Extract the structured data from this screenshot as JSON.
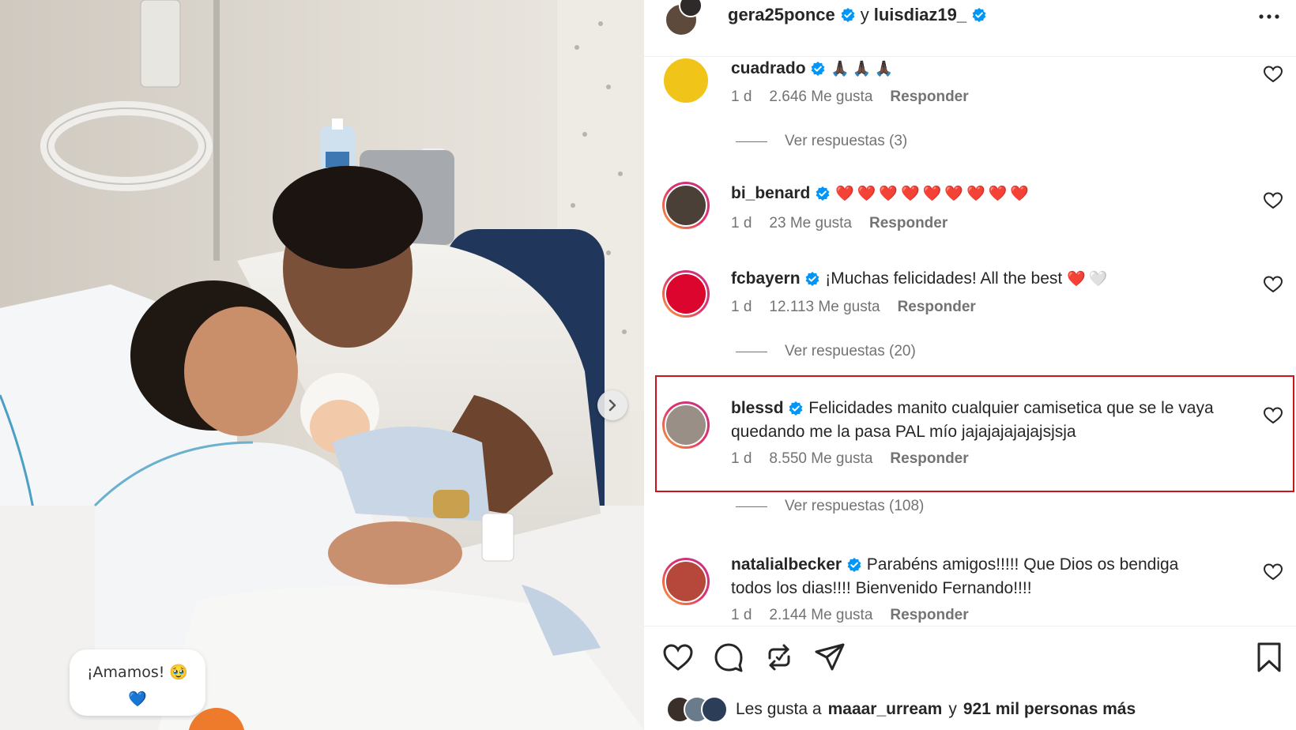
{
  "photo": {
    "overlay_text": "¡Amamos! 🥹",
    "overlay_emoji": "💙",
    "next_icon": "chevron-right-icon"
  },
  "header": {
    "user1": "gera25ponce",
    "connector": "y",
    "user2": "luisdiaz19_",
    "more_icon": "more-options-icon"
  },
  "comments": [
    {
      "user": "cuadrado",
      "verified": true,
      "text": "",
      "emoji": "🙏🏿🙏🏿🙏🏿",
      "time": "1 d",
      "likes": "2.646 Me gusta",
      "reply": "Responder",
      "view_replies": "Ver respuestas (3)",
      "avatar_color": "#f0c419"
    },
    {
      "user": "bi_benard",
      "verified": true,
      "text": "",
      "emoji": "❤️❤️❤️❤️❤️❤️❤️❤️❤️",
      "time": "1 d",
      "likes": "23 Me gusta",
      "reply": "Responder",
      "view_replies": "",
      "avatar_color": "#4a4038"
    },
    {
      "user": "fcbayern",
      "verified": true,
      "text": "¡Muchas felicidades! All the best",
      "emoji": "❤️🤍",
      "time": "1 d",
      "likes": "12.113 Me gusta",
      "reply": "Responder",
      "view_replies": "Ver respuestas (20)",
      "avatar_color": "#dc052d"
    },
    {
      "user": "blessd",
      "verified": true,
      "text": "Felicidades manito cualquier camisetica que se le vaya quedando me la pasa PAL mío jajajajajajajsjsja",
      "emoji": "",
      "time": "1 d",
      "likes": "8.550 Me gusta",
      "reply": "Responder",
      "view_replies": "Ver respuestas (108)",
      "avatar_color": "#9a8f86"
    },
    {
      "user": "natalialbecker",
      "verified": true,
      "text": "Parabéns amigos!!!!! Que Dios os bendiga todos los dias!!!! Bienvenido Fernando!!!!",
      "emoji": "",
      "time": "1 d",
      "likes": "2.144 Me gusta",
      "reply": "Responder",
      "view_replies": "",
      "avatar_color": "#b5483a"
    }
  ],
  "actions": {
    "like_icon": "heart-icon",
    "comment_icon": "comment-icon",
    "repost_icon": "repost-icon",
    "share_icon": "share-icon",
    "save_icon": "bookmark-icon"
  },
  "likes": {
    "prefix": "Les gusta a",
    "user": "maaar_urream",
    "connector": "y",
    "others": "921 mil personas más"
  },
  "colors": {
    "verified": "#0095f6",
    "highlight": "#c9151b",
    "muted": "#737373"
  }
}
